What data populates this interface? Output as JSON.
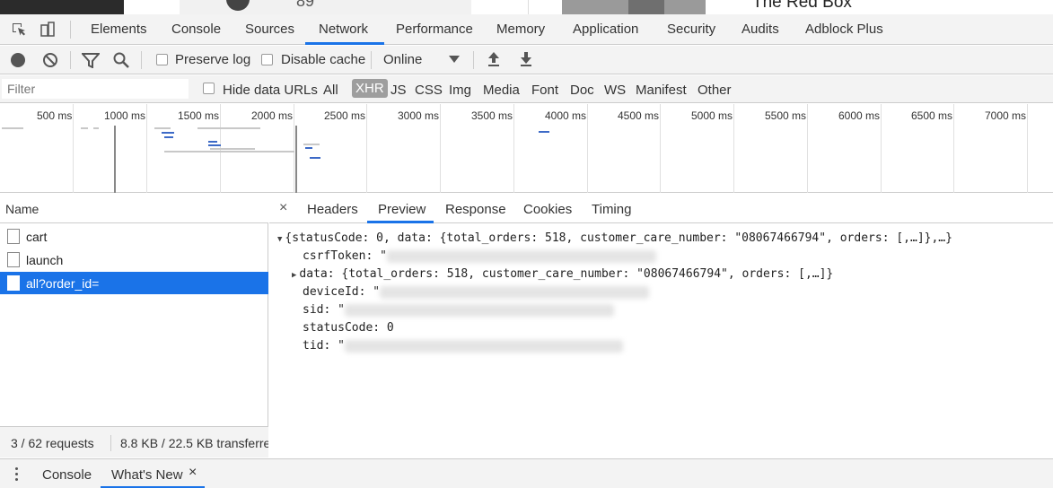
{
  "page": {
    "score_partial": "89",
    "title_partial": "The Red Box"
  },
  "devtools": {
    "tabs": [
      "Elements",
      "Console",
      "Sources",
      "Network",
      "Performance",
      "Memory",
      "Application",
      "Security",
      "Audits",
      "Adblock Plus"
    ],
    "active_tab": "Network"
  },
  "toolbar": {
    "preserve_log": "Preserve log",
    "disable_cache": "Disable cache",
    "throttling": "Online"
  },
  "filterbar": {
    "placeholder": "Filter",
    "hide_data_urls": "Hide data URLs",
    "types": [
      "All",
      "XHR",
      "JS",
      "CSS",
      "Img",
      "Media",
      "Font",
      "Doc",
      "WS",
      "Manifest",
      "Other"
    ],
    "active_type": "XHR"
  },
  "overview": {
    "ticks": [
      "500 ms",
      "1000 ms",
      "1500 ms",
      "2000 ms",
      "2500 ms",
      "3000 ms",
      "3500 ms",
      "4000 ms",
      "4500 ms",
      "5000 ms",
      "5500 ms",
      "6000 ms",
      "6500 ms",
      "7000 ms"
    ]
  },
  "requests": {
    "header": "Name",
    "items": [
      {
        "name": "cart"
      },
      {
        "name": "launch"
      },
      {
        "name": "all?order_id="
      }
    ],
    "selected_index": 2
  },
  "status": {
    "requests": "3 / 62 requests",
    "transferred": "8.8 KB / 22.5 KB transferred"
  },
  "detail": {
    "close": "×",
    "tabs": [
      "Headers",
      "Preview",
      "Response",
      "Cookies",
      "Timing"
    ],
    "active_tab": "Preview",
    "preview": {
      "root": "{statusCode: 0, data: {total_orders: 518, customer_care_number: \"08067466794\", orders: [,…]},…}",
      "csrf_key": "csrfToken: \"",
      "data_line": "data: {total_orders: 518, customer_care_number: \"08067466794\", orders: [,…]}",
      "device_key": "deviceId: \"",
      "sid_key": "sid: \"",
      "status_line": "statusCode: 0",
      "tid_key": "tid: \""
    }
  },
  "drawer": {
    "tabs": [
      "Console",
      "What's New"
    ],
    "active_tab": "What's New",
    "close": "×"
  }
}
